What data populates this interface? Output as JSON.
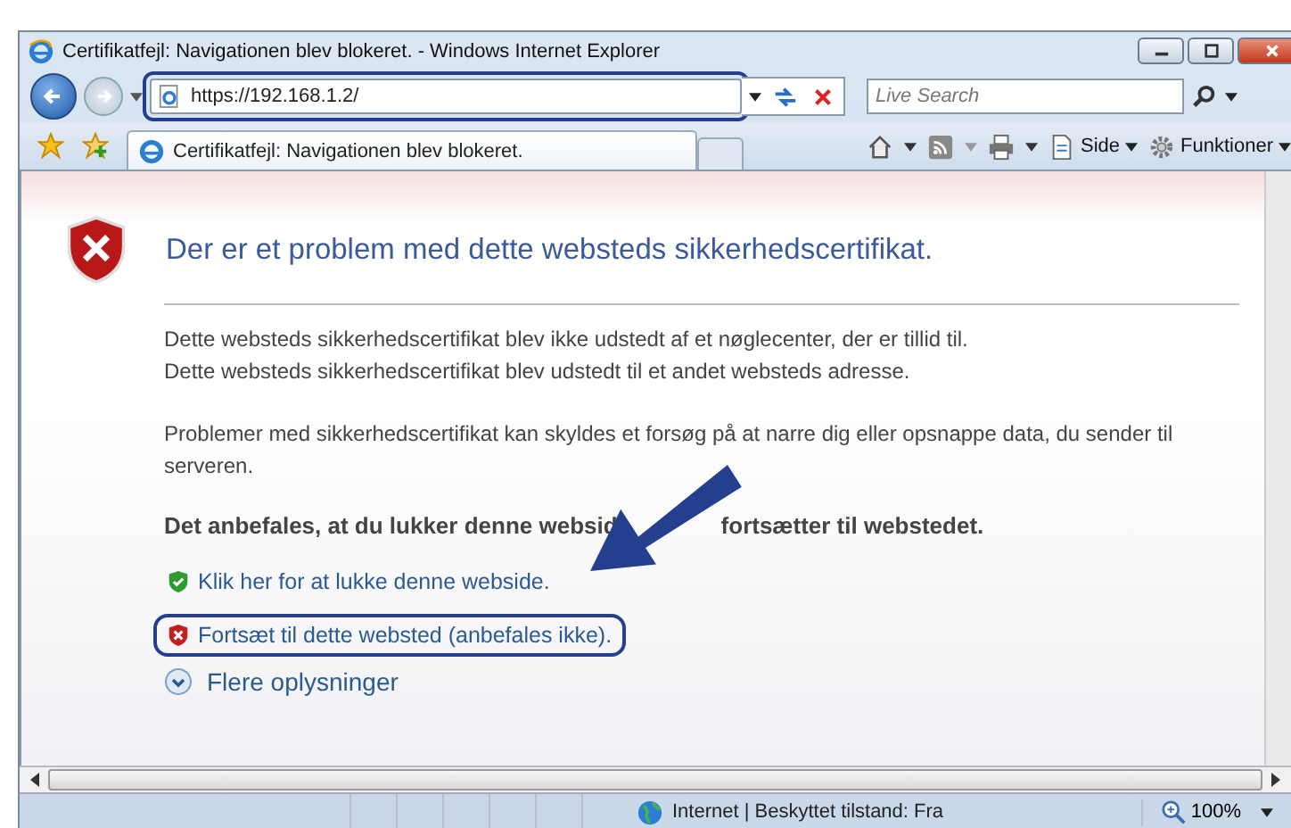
{
  "window": {
    "title": "Certifikatfejl: Navigationen blev blokeret. - Windows Internet Explorer"
  },
  "navigation": {
    "address": "https://192.168.1.2/",
    "address_highlighted": true,
    "search": {
      "placeholder": "Live Search"
    }
  },
  "tab": {
    "label": "Certifikatfejl: Navigationen blev blokeret.",
    "selected": true
  },
  "commands": [
    {
      "kind": "page",
      "label": "Side"
    },
    {
      "kind": "tools",
      "label": "Funktioner"
    }
  ],
  "content": {
    "heading": "Der er et problem med dette websteds sikkerhedscertifikat.",
    "lines": [
      "Dette websteds sikkerhedscertifikat blev ikke udstedt af et nøglecenter, der er tillid til.",
      "Dette websteds sikkerhedscertifikat blev udstedt til et andet websteds adresse."
    ],
    "warning": "Problemer med sikkerhedscertifikat kan skyldes et forsøg på at narre dig eller opsnappe data, du sender til serveren.",
    "recommendation": [
      "Det anbefales, at du lukker denne websid",
      "fortsætter til webstedet."
    ],
    "links": [
      {
        "kind": "close",
        "text": "Klik her for at lukke denne webside.",
        "highlighted": false
      },
      {
        "kind": "continue",
        "text": "Fortsæt til dette websted (anbefales ikke).",
        "highlighted": true
      }
    ],
    "more": "Flere oplysninger"
  },
  "status_bar": {
    "zone": "Internet | Beskyttet tilstand: Fra",
    "zoom": "100%"
  }
}
